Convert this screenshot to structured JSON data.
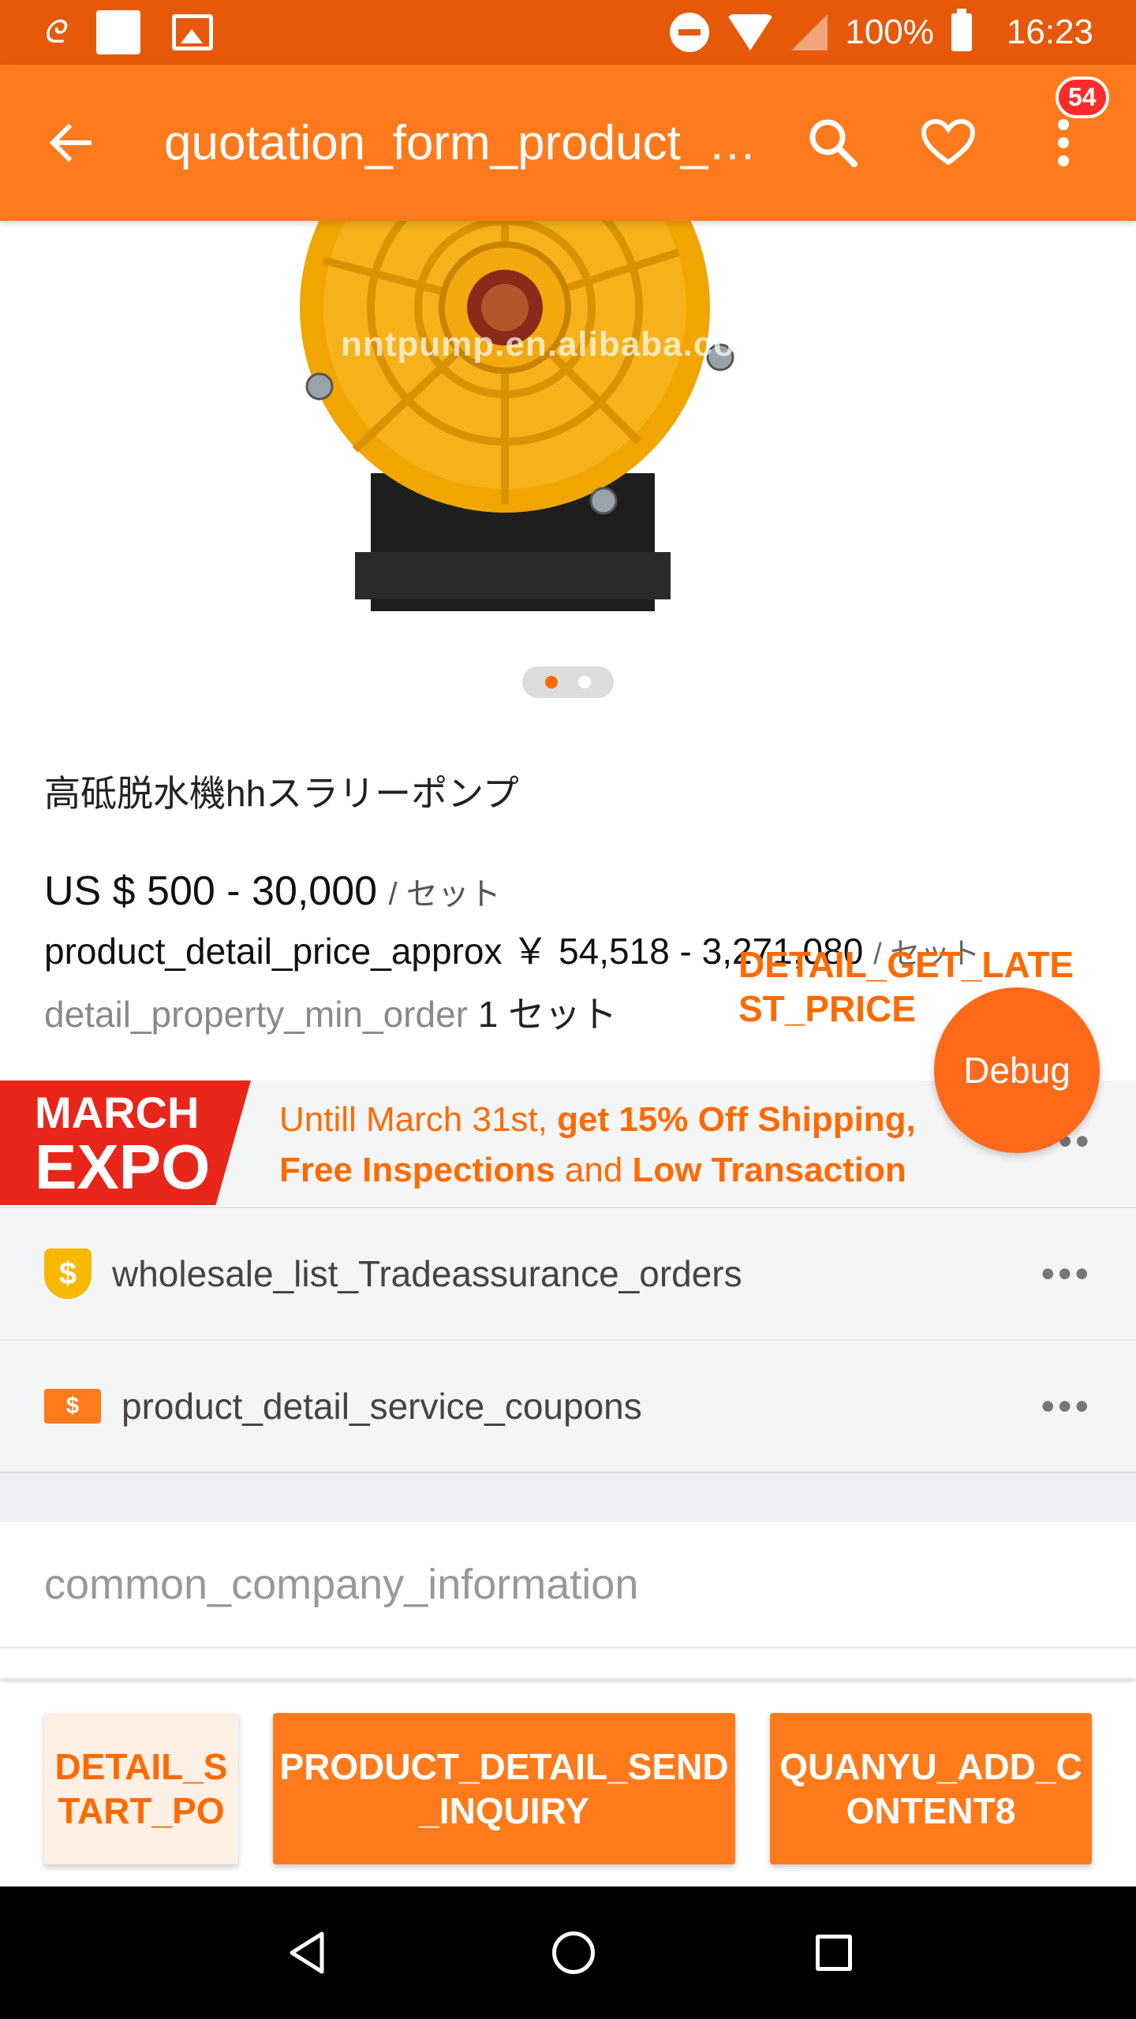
{
  "status_bar": {
    "battery": "100%",
    "time": "16:23",
    "icons": [
      "alibaba-icon",
      "square-notification-icon",
      "image-notification-icon",
      "do-not-disturb-icon",
      "wifi-icon",
      "signal-icon",
      "battery-icon"
    ]
  },
  "app_bar": {
    "title": "quotation_form_product_name",
    "badge_count": "54",
    "icons": [
      "back-arrow-icon",
      "search-icon",
      "heart-icon",
      "more-vert-icon"
    ]
  },
  "product": {
    "watermark": "nntpump.en.alibaba.com",
    "pager_total": 2,
    "pager_active": 1,
    "title": "高砥脱水機hhスラリーポンプ",
    "price": "US $ 500 - 30,000",
    "price_unit": "/ セット",
    "approx_label": "product_detail_price_approx",
    "approx_value": "￥ 54,518 - 3,271,080",
    "approx_unit": "/ セット",
    "min_order_label": "detail_property_min_order",
    "min_order_value": "1 セット",
    "latest_price_link": "DETAIL_GET_LATEST_PRICE"
  },
  "debug_button": "Debug",
  "expo_banner": {
    "badge_line1": "MARCH",
    "badge_line2": "EXPO",
    "text_part1": "Untill March 31st, ",
    "text_bold1": "get 15% Off Shipping,",
    "text_bold2": "Free Inspections",
    "text_part2": " and ",
    "text_bold3": "Low Transaction",
    "more": "•••"
  },
  "service_rows": [
    {
      "label": "wholesale_list_Tradeassurance_orders",
      "icon_text": "$",
      "more": "•••"
    },
    {
      "label": "product_detail_service_coupons",
      "icon_text": "$",
      "more": "•••"
    }
  ],
  "company": {
    "label": "common_company_information"
  },
  "action_bar": {
    "start_order": "DETAIL_START_PO",
    "send_inquiry": "PRODUCT_DETAIL_SEND_INQUIRY",
    "add_content": "QUANYU_ADD_CONTENT8"
  },
  "colors": {
    "status_bar": "#e6590b",
    "accent": "#ff7a1c",
    "link_orange": "#ff6a00",
    "expo_red": "#e8261a"
  }
}
